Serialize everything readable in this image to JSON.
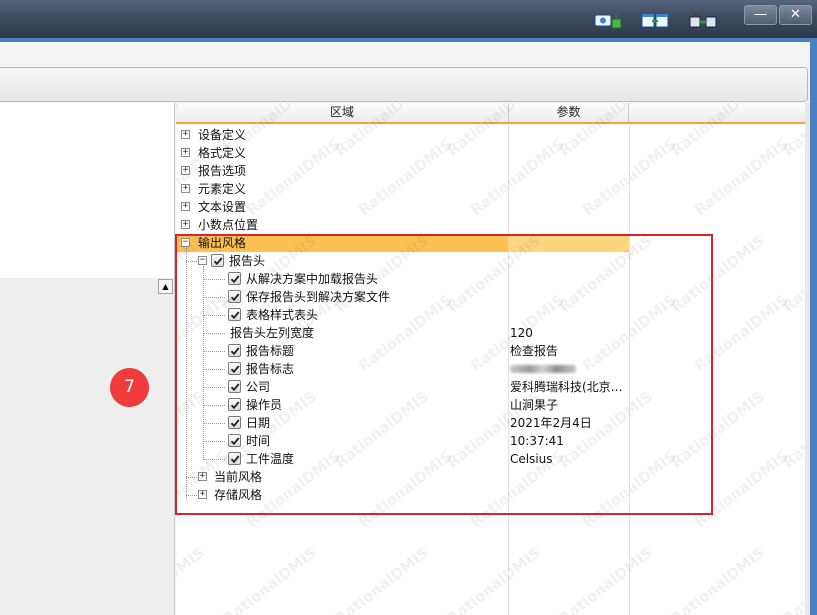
{
  "window": {
    "minimize": "—",
    "close": "✕",
    "toolbar_icons": [
      "camera-mic-icon",
      "window-layout-icon",
      "connect-icon"
    ]
  },
  "grid": {
    "columns": [
      "区域",
      "参数"
    ],
    "rows": [
      {
        "label": "设备定义",
        "expander": "+",
        "level": 0
      },
      {
        "label": "格式定义",
        "expander": "+",
        "level": 0
      },
      {
        "label": "报告选项",
        "expander": "+",
        "level": 0
      },
      {
        "label": "元素定义",
        "expander": "+",
        "level": 0
      },
      {
        "label": "文本设置",
        "expander": "+",
        "level": 0
      },
      {
        "label": "小数点位置",
        "expander": "+",
        "level": 0
      },
      {
        "label": "输出风格",
        "expander": "−",
        "level": 0,
        "selected": true
      },
      {
        "label": "报告头",
        "expander": "−",
        "level": 1,
        "checked": true
      },
      {
        "label": "从解决方案中加载报告头",
        "level": 2,
        "checked": true
      },
      {
        "label": "保存报告头到解决方案文件",
        "level": 2,
        "checked": true
      },
      {
        "label": "表格样式表头",
        "level": 2,
        "checked": true
      },
      {
        "label": "报告头左列宽度",
        "level": 2,
        "value": "120"
      },
      {
        "label": "报告标题",
        "level": 2,
        "checked": true,
        "value": "检查报告"
      },
      {
        "label": "报告标志",
        "level": 2,
        "checked": true,
        "blurred": true
      },
      {
        "label": "公司",
        "level": 2,
        "checked": true,
        "value": "爱科腾瑞科技(北京…"
      },
      {
        "label": "操作员",
        "level": 2,
        "checked": true,
        "value": "山涧果子"
      },
      {
        "label": "日期",
        "level": 2,
        "checked": true,
        "value": "2021年2月4日"
      },
      {
        "label": "时间",
        "level": 2,
        "checked": true,
        "value": "10:37:41"
      },
      {
        "label": "工件温度",
        "level": 2,
        "checked": true,
        "value": "Celsius"
      },
      {
        "label": "当前风格",
        "expander": "+",
        "level": 1
      },
      {
        "label": "存储风格",
        "expander": "+",
        "level": 1
      }
    ]
  },
  "annotation": {
    "step": "7",
    "color": "#d9232e"
  },
  "watermark_text": "RationalDMIS",
  "colors": {
    "selected_row": "#fcc152",
    "header_accent": "#f2a53a",
    "frame": "#4a7fc0"
  }
}
